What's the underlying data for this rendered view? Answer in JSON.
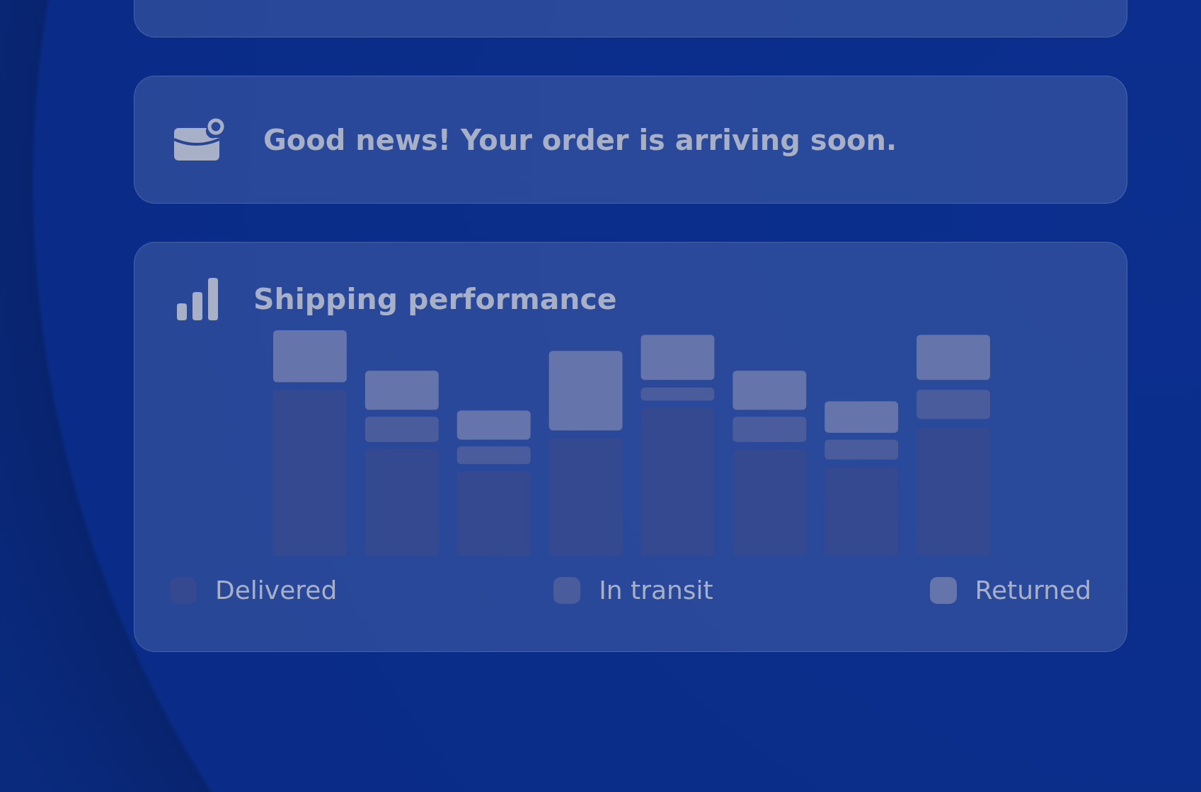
{
  "notice": {
    "message": "Good news! Your order is arriving soon."
  },
  "performance": {
    "title": "Shipping performance",
    "legend": [
      {
        "label": "Delivered",
        "color": "#34498f"
      },
      {
        "label": "In transit",
        "color": "#4a5c9c"
      },
      {
        "label": "Returned",
        "color": "#6574aa"
      }
    ]
  }
}
